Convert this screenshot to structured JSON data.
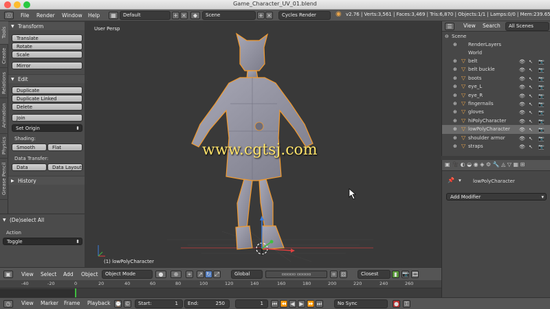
{
  "window": {
    "title": "Game_Character_UV_01.blend"
  },
  "menubar": {
    "menus": [
      "File",
      "Render",
      "Window",
      "Help"
    ],
    "layout": "Default",
    "scene": "Scene",
    "engine": "Cycles Render",
    "stats": "v2.76 | Verts:3,561 | Faces:3,469 | Tris:6,870 | Objects:1/1 | Lamps:0/0 | Mem:239.65M"
  },
  "tabs": [
    "Tools",
    "Create",
    "Relations",
    "Animation",
    "Physics",
    "Grease Pencil"
  ],
  "tool_panel": {
    "transform": {
      "title": "Transform",
      "buttons": [
        "Translate",
        "Rotate",
        "Scale",
        "Mirror"
      ]
    },
    "edit": {
      "title": "Edit",
      "buttons": [
        "Duplicate",
        "Duplicate Linked",
        "Delete",
        "Join"
      ],
      "set_origin": "Set Origin",
      "shading_label": "Shading:",
      "smooth": "Smooth",
      "flat": "Flat",
      "transfer_label": "Data Transfer:",
      "data": "Data",
      "data_layout": "Data Layout"
    },
    "history": {
      "title": "History"
    }
  },
  "redo": {
    "title": "(De)select All",
    "action_label": "Action",
    "action_value": "Toggle"
  },
  "viewport": {
    "label": "User Persp",
    "object_label": "(1) lowPolyCharacter",
    "watermark": "www.cgtsj.com"
  },
  "view_header": {
    "menus": [
      "View",
      "Select",
      "Add",
      "Object"
    ],
    "mode": "Object Mode",
    "orientation": "Global",
    "snap": "Closest"
  },
  "timeline": {
    "ticks": [
      "-40",
      "-20",
      "0",
      "20",
      "40",
      "60",
      "80",
      "100",
      "120",
      "140",
      "160",
      "180",
      "200",
      "220",
      "240",
      "260"
    ]
  },
  "time_header": {
    "menus": [
      "View",
      "Marker",
      "Frame",
      "Playback"
    ],
    "start": "Start:",
    "start_val": "1",
    "end": "End:",
    "end_val": "250",
    "frame": "1",
    "sync": "No Sync"
  },
  "outliner": {
    "menus": [
      "View",
      "Search",
      "All Scenes"
    ],
    "items": [
      "Scene",
      "RenderLayers",
      "World",
      "belt",
      "belt buckle",
      "boots",
      "eye_L",
      "eye_R",
      "fingernails",
      "gloves",
      "hiPolyCharacter",
      "lowPolyCharacter",
      "shoulder armor",
      "straps"
    ]
  },
  "properties": {
    "object": "lowPolyCharacter",
    "add_modifier": "Add Modifier"
  },
  "colors": {
    "accent": "#e8a44a",
    "select": "#f29a2e",
    "watermark": "#ffe36a"
  }
}
